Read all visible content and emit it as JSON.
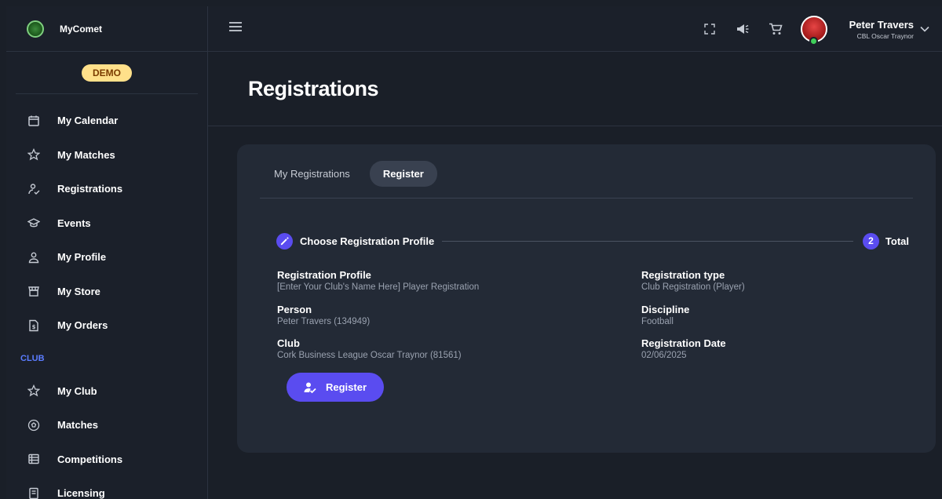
{
  "brand": {
    "name": "MyComet",
    "demo_badge": "DEMO"
  },
  "sidebar": {
    "items": [
      {
        "label": "My Calendar",
        "icon": "calendar-icon"
      },
      {
        "label": "My Matches",
        "icon": "star-icon"
      },
      {
        "label": "Registrations",
        "icon": "person-check-icon"
      },
      {
        "label": "Events",
        "icon": "graduation-cap-icon"
      },
      {
        "label": "My Profile",
        "icon": "person-icon"
      },
      {
        "label": "My Store",
        "icon": "store-icon"
      },
      {
        "label": "My Orders",
        "icon": "receipt-icon"
      }
    ],
    "club_section": "CLUB",
    "club_items": [
      {
        "label": "My Club",
        "icon": "star-icon"
      },
      {
        "label": "Matches",
        "icon": "soccer-ball-icon"
      },
      {
        "label": "Competitions",
        "icon": "list-icon"
      },
      {
        "label": "Licensing",
        "icon": "document-icon"
      }
    ]
  },
  "topbar": {
    "user_name": "Peter Travers",
    "user_club": "CBL Oscar Traynor"
  },
  "page": {
    "title": "Registrations"
  },
  "tabs": [
    {
      "label": "My Registrations",
      "active": false
    },
    {
      "label": "Register",
      "active": true
    }
  ],
  "stepper": {
    "step1_label": "Choose Registration Profile",
    "step2_number": "2",
    "step2_label": "Total"
  },
  "details": {
    "registration_profile_label": "Registration Profile",
    "registration_profile_value": "[Enter Your Club's Name Here] Player Registration",
    "person_label": "Person",
    "person_value": "Peter Travers (134949)",
    "club_label": "Club",
    "club_value": "Cork Business League Oscar Traynor (81561)",
    "registration_type_label": "Registration type",
    "registration_type_value": "Club Registration (Player)",
    "discipline_label": "Discipline",
    "discipline_value": "Football",
    "registration_date_label": "Registration Date",
    "registration_date_value": "02/06/2025"
  },
  "register_button": {
    "label": "Register"
  },
  "colors": {
    "accent": "#5a4cf0",
    "section": "#5b7cff",
    "demo_badge": "#ffe08a",
    "card": "#232a36",
    "background": "#1a1f28"
  }
}
